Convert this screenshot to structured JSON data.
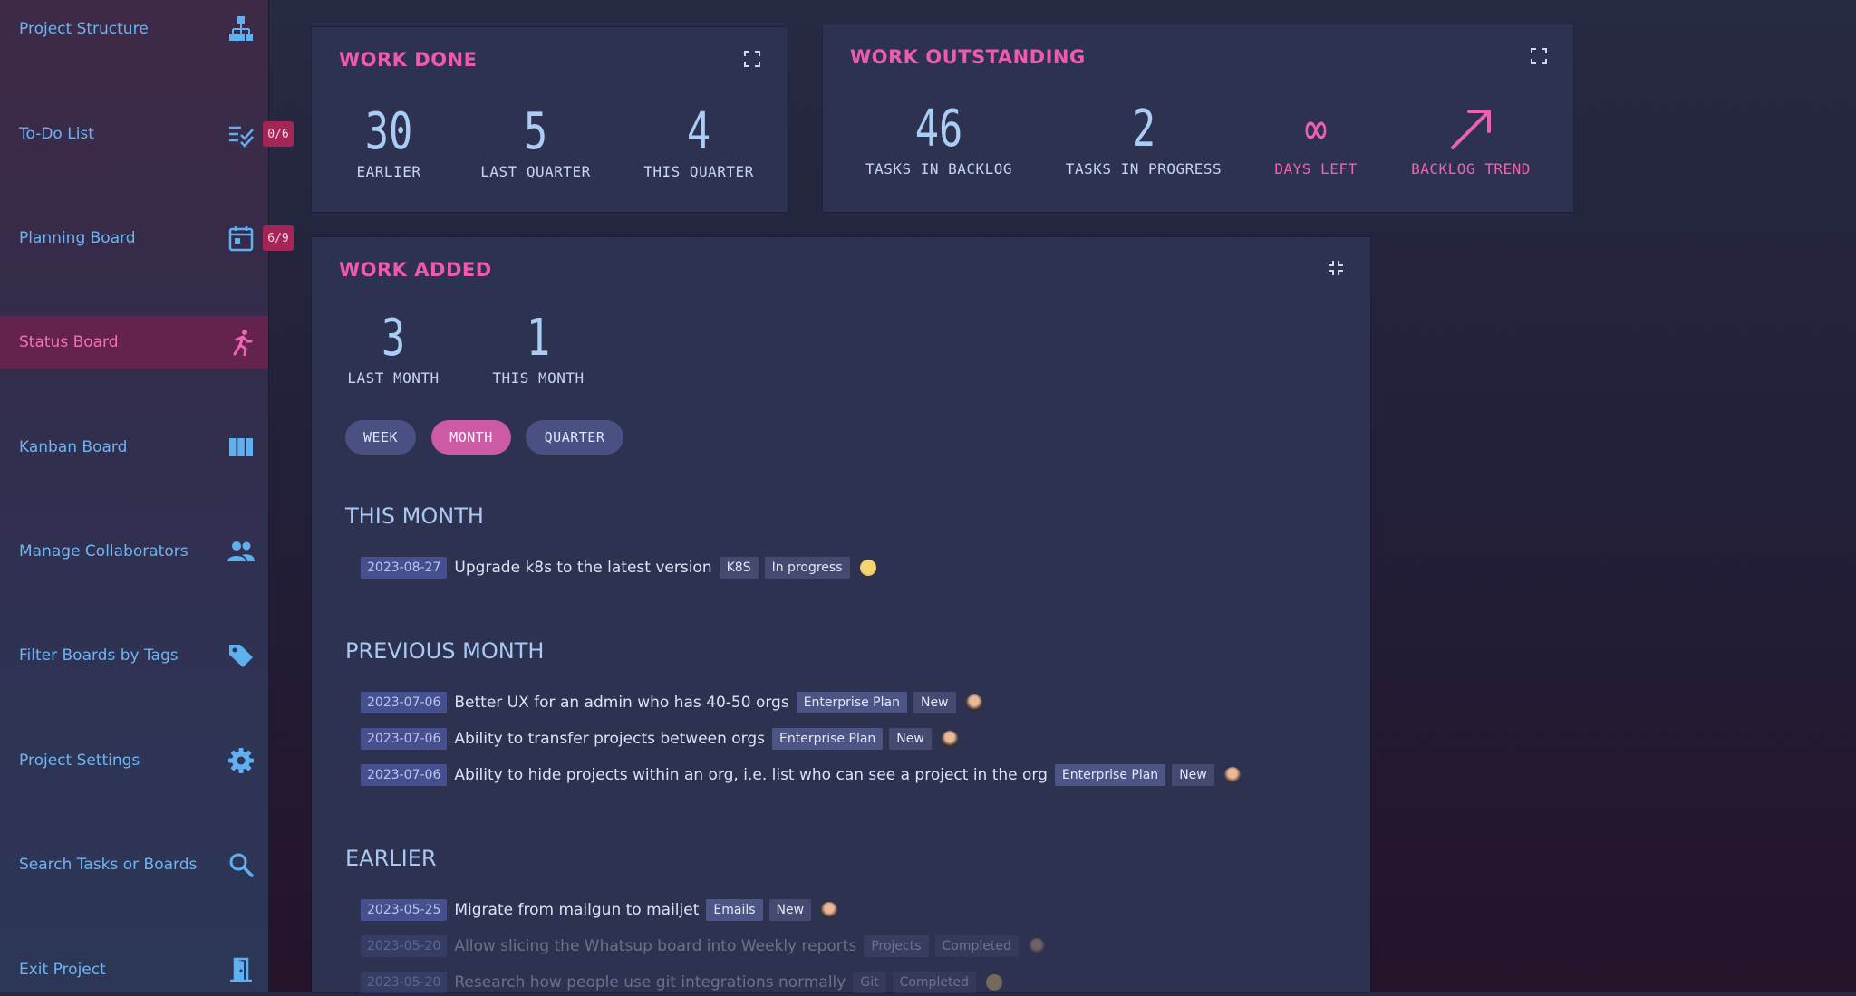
{
  "sidebar": {
    "items": [
      {
        "label": "Project Structure",
        "icon": "hierarchy-icon"
      },
      {
        "label": "To-Do List",
        "icon": "checklist-icon",
        "badge": "0/6"
      },
      {
        "label": "Planning Board",
        "icon": "calendar-icon",
        "badge": "6/9"
      },
      {
        "label": "Status Board",
        "icon": "runner-icon",
        "active": true
      },
      {
        "label": "Kanban Board",
        "icon": "columns-icon"
      },
      {
        "label": "Manage Collaborators",
        "icon": "people-icon"
      },
      {
        "label": "Filter Boards by Tags",
        "icon": "tag-icon"
      },
      {
        "label": "Project Settings",
        "icon": "gear-icon"
      },
      {
        "label": "Search Tasks or Boards",
        "icon": "search-icon"
      },
      {
        "label": "Exit Project",
        "icon": "door-exit-icon"
      }
    ]
  },
  "work_done": {
    "title": "WORK DONE",
    "stats": [
      {
        "value": "30",
        "label": "EARLIER"
      },
      {
        "value": "5",
        "label": "LAST QUARTER"
      },
      {
        "value": "4",
        "label": "THIS QUARTER"
      }
    ]
  },
  "work_outstanding": {
    "title": "WORK OUTSTANDING",
    "stats": [
      {
        "value": "46",
        "label": "TASKS IN BACKLOG"
      },
      {
        "value": "2",
        "label": "TASKS IN PROGRESS"
      },
      {
        "value": "∞",
        "label": "DAYS LEFT"
      },
      {
        "label": "BACKLOG TREND"
      }
    ]
  },
  "work_added": {
    "title": "WORK ADDED",
    "stats": [
      {
        "value": "3",
        "label": "LAST MONTH"
      },
      {
        "value": "1",
        "label": "THIS MONTH"
      }
    ],
    "periods": [
      "WEEK",
      "MONTH",
      "QUARTER"
    ],
    "active_period": "MONTH",
    "sections": [
      {
        "heading": "THIS MONTH",
        "tasks": [
          {
            "date": "2023-08-27",
            "text": "Upgrade k8s to the latest version",
            "tags": [
              "K8S",
              "In progress"
            ]
          }
        ]
      },
      {
        "heading": "PREVIOUS MONTH",
        "tasks": [
          {
            "date": "2023-07-06",
            "text": "Better UX for an admin who has 40-50 orgs",
            "tags": [
              "Enterprise Plan",
              "New"
            ]
          },
          {
            "date": "2023-07-06",
            "text": "Ability to transfer projects between orgs",
            "tags": [
              "Enterprise Plan",
              "New"
            ]
          },
          {
            "date": "2023-07-06",
            "text": "Ability to hide projects within an org, i.e. list who can see a project in the org",
            "tags": [
              "Enterprise Plan",
              "New"
            ]
          }
        ]
      },
      {
        "heading": "EARLIER",
        "tasks": [
          {
            "date": "2023-05-25",
            "text": "Migrate from mailgun to mailjet",
            "tags": [
              "Emails",
              "New"
            ]
          },
          {
            "date": "2023-05-20",
            "text": "Allow slicing the Whatsup board into Weekly reports",
            "tags": [
              "Projects",
              "Completed"
            ]
          },
          {
            "date": "2023-05-20",
            "text": "Research how people use git integrations normally",
            "tags": [
              "Git",
              "Completed"
            ]
          }
        ]
      }
    ]
  },
  "colors": {
    "accent_pink": "#f05aae",
    "link_blue": "#6cb4f2",
    "badge": "#a52656",
    "card": "#2d3250"
  }
}
